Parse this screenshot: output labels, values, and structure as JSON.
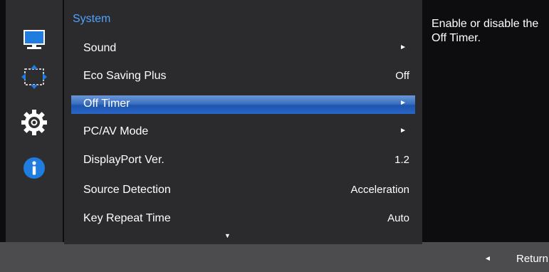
{
  "menu": {
    "title": "System",
    "items": [
      {
        "label": "Sound",
        "value": "",
        "arrow": "►"
      },
      {
        "label": "Eco Saving Plus",
        "value": "Off",
        "arrow": ""
      },
      {
        "label": "Off Timer",
        "value": "",
        "arrow": "►"
      },
      {
        "label": "PC/AV Mode",
        "value": "",
        "arrow": "►"
      },
      {
        "label": "DisplayPort Ver.",
        "value": "1.2",
        "arrow": ""
      },
      {
        "label": "Source Detection",
        "value": "Acceleration",
        "arrow": ""
      },
      {
        "label": "Key Repeat Time",
        "value": "Auto",
        "arrow": ""
      }
    ],
    "selected_index": 2,
    "scroll_indicator": "▼"
  },
  "rail": {
    "icons": [
      "picture-icon",
      "onscreen-display-icon",
      "system-gear-icon",
      "information-icon"
    ],
    "active": "system-gear-icon"
  },
  "help": {
    "text": "Enable or disable the Off Timer."
  },
  "footer": {
    "return_icon": "◄",
    "return_label": "Return"
  },
  "colors": {
    "accent": "#4fa3ff",
    "selected_row": "#2a66c6",
    "panel": "#2b2b2e",
    "rail": "#2e2e31",
    "background": "#0d0d0f",
    "footer": "#4c4c4f"
  }
}
